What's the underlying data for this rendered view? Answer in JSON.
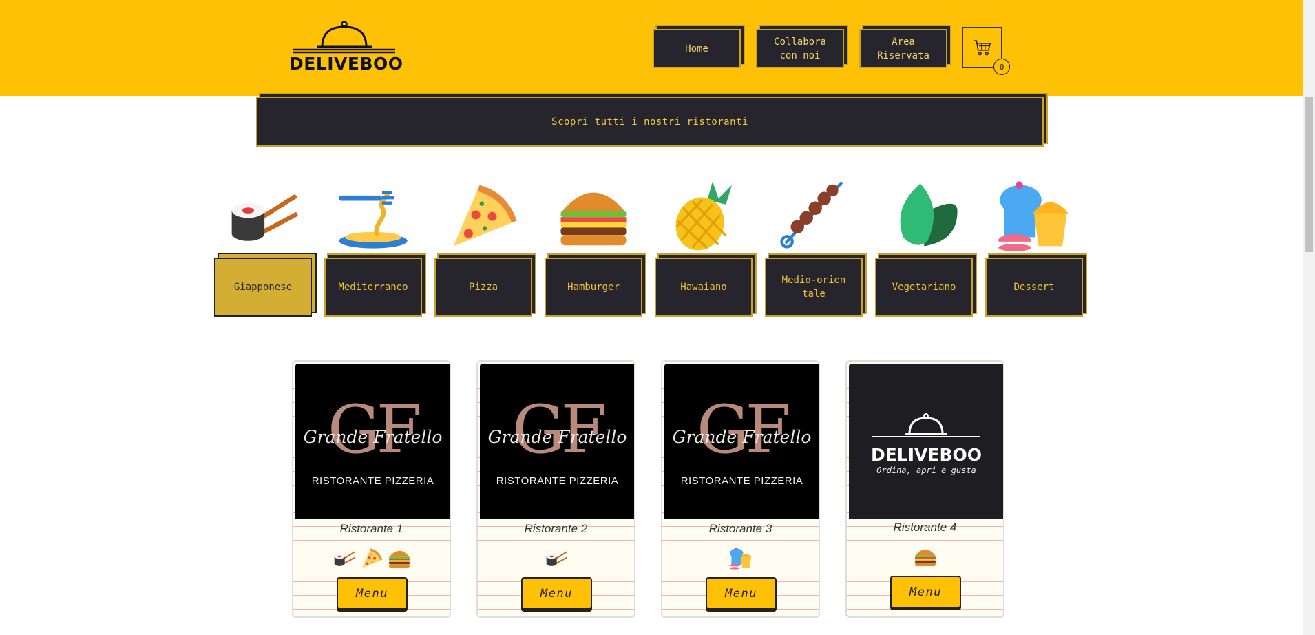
{
  "brand": {
    "logo_text": "DELIVEBOO"
  },
  "nav": [
    {
      "label": "Home"
    },
    {
      "label": "Collabora con noi"
    },
    {
      "label": "Area Riservata"
    }
  ],
  "cart": {
    "count": "0",
    "icon": "cart-icon"
  },
  "banner": {
    "label": "Scopri tutti i nostri ristoranti"
  },
  "categories": [
    {
      "label": "Giapponese",
      "icon": "sushi-icon",
      "active": true
    },
    {
      "label": "Mediterraneo",
      "icon": "pasta-icon"
    },
    {
      "label": "Pizza",
      "icon": "pizza-icon"
    },
    {
      "label": "Hamburger",
      "icon": "burger-icon"
    },
    {
      "label": "Hawaiano",
      "icon": "pineapple-icon"
    },
    {
      "label": "Medio-orientale",
      "icon": "kebab-icon"
    },
    {
      "label": "Vegetariano",
      "icon": "leaf-icon"
    },
    {
      "label": "Dessert",
      "icon": "cupcake-icon"
    }
  ],
  "restaurants": [
    {
      "name": "Ristorante 1",
      "logo_monogram": "GF",
      "logo_script": "Grande Fratello",
      "logo_sub": "RISTORANTE PIZZERIA",
      "categories": [
        "sushi-icon",
        "pizza-icon",
        "burger-icon"
      ],
      "menu_label": "Menu"
    },
    {
      "name": "Ristorante 2",
      "logo_monogram": "GF",
      "logo_script": "Grande Fratello",
      "logo_sub": "RISTORANTE PIZZERIA",
      "categories": [
        "sushi-icon"
      ],
      "menu_label": "Menu"
    },
    {
      "name": "Ristorante 3",
      "logo_monogram": "GF",
      "logo_script": "Grande Fratello",
      "logo_sub": "RISTORANTE PIZZERIA",
      "categories": [
        "cupcake-icon"
      ],
      "menu_label": "Menu"
    },
    {
      "name": "Ristorante 4",
      "logo_title": "DELIVEBOO",
      "logo_tagline": "Ordina, apri e gusta",
      "categories": [
        "burger-icon"
      ],
      "menu_label": "Menu"
    }
  ],
  "colors": {
    "header": "#ffc106",
    "dark": "#26252d",
    "accent_text": "#f1c232"
  }
}
